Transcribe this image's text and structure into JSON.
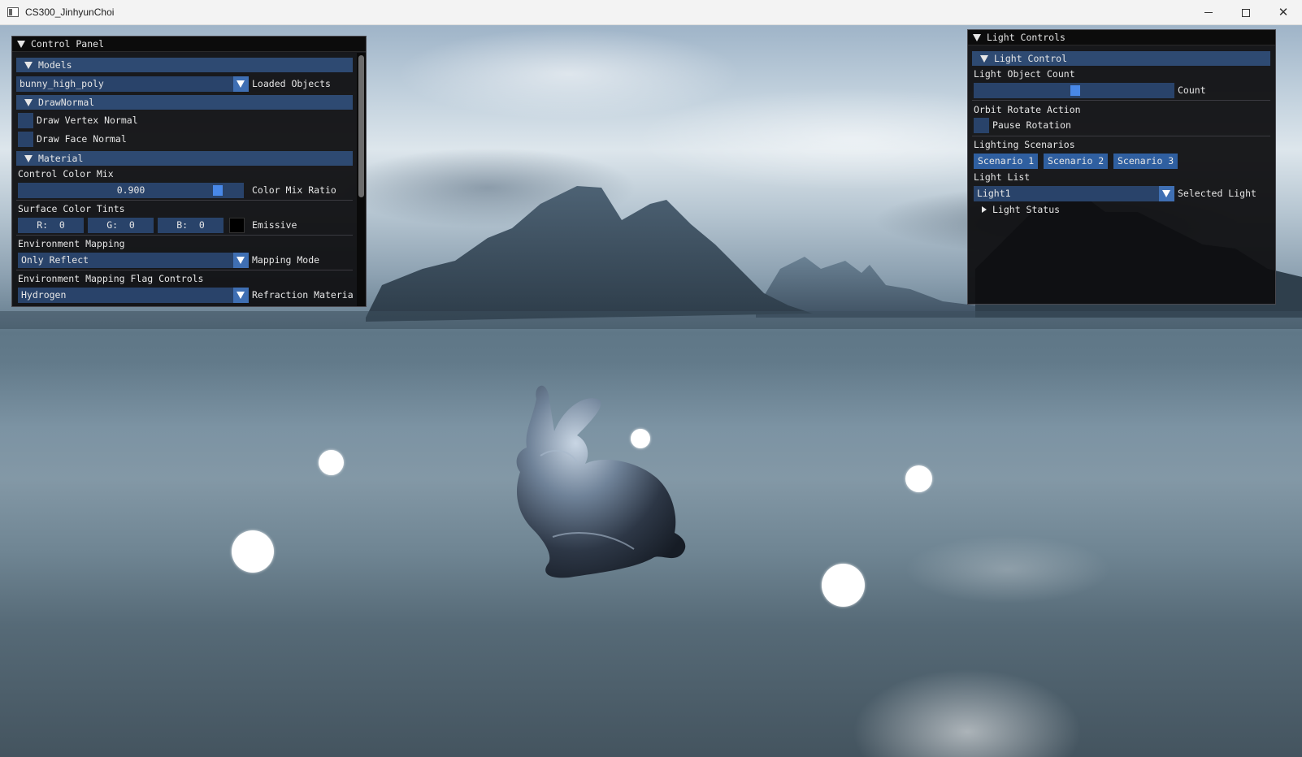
{
  "window": {
    "title": "CS300_JinhyunChoi",
    "icons": [
      "app-icon",
      "minimize-icon",
      "maximize-icon",
      "close-icon"
    ]
  },
  "control_panel": {
    "title": "Control Panel",
    "models": {
      "header": "Models",
      "combo_value": "bunny_high_poly",
      "combo_label": "Loaded Objects"
    },
    "draw_normal": {
      "header": "DrawNormal",
      "vertex_normal": "Draw Vertex Normal",
      "face_normal": "Draw Face Normal"
    },
    "material": {
      "header": "Material",
      "color_mix_title": "Control Color Mix",
      "color_mix_value": "0.900",
      "color_mix_fraction": 0.9,
      "color_mix_label": "Color Mix Ratio",
      "tints_title": "Surface Color Tints",
      "r": "R:  0",
      "g": "G:  0",
      "b": "B:  0",
      "emissive_color": "#000000",
      "emissive_label": "Emissive",
      "env_title": "Environment Mapping",
      "env_value": "Only Reflect",
      "env_label": "Mapping Mode",
      "flag_title": "Environment Mapping Flag Controls",
      "flag_value": "Hydrogen",
      "flag_label": "Refraction Materia"
    }
  },
  "light_panel": {
    "title": "Light Controls",
    "header": "Light Control",
    "count_title": "Light Object Count",
    "count_value": "5",
    "count_fraction": 0.5,
    "count_label": "Count",
    "orbit_title": "Orbit Rotate Action",
    "pause_label": "Pause Rotation",
    "scenarios_title": "Lighting Scenarios",
    "scenarios": [
      "Scenario 1",
      "Scenario 2",
      "Scenario 3"
    ],
    "list_title": "Light List",
    "list_value": "Light1",
    "list_label": "Selected Light",
    "status_label": "Light Status"
  },
  "colors": {
    "panel_bg": "#0e0e10",
    "header_bg": "#2e4a72",
    "frame_bg": "#29436a",
    "button_bg": "#2f5fa0",
    "slider_grab": "#4888e8",
    "text": "#e6e6e6"
  }
}
